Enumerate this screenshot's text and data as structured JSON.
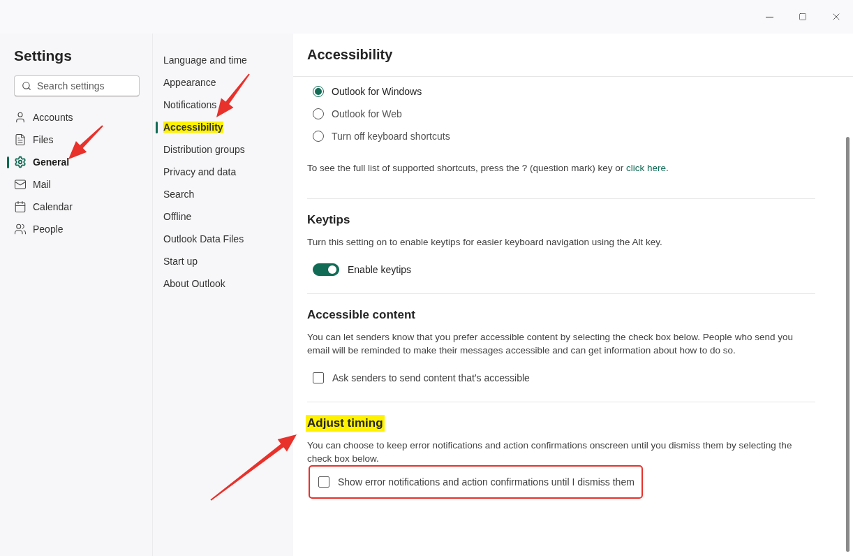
{
  "nav": {
    "title": "Settings",
    "search": {
      "placeholder": "Search settings"
    },
    "items": [
      {
        "label": "Accounts",
        "selected": false
      },
      {
        "label": "Files",
        "selected": false
      },
      {
        "label": "General",
        "selected": true
      },
      {
        "label": "Mail",
        "selected": false
      },
      {
        "label": "Calendar",
        "selected": false
      },
      {
        "label": "People",
        "selected": false
      }
    ]
  },
  "subnav": {
    "items": [
      {
        "label": "Language and time",
        "selected": false,
        "highlighted": false
      },
      {
        "label": "Appearance",
        "selected": false,
        "highlighted": false
      },
      {
        "label": "Notifications",
        "selected": false,
        "highlighted": false
      },
      {
        "label": "Accessibility",
        "selected": true,
        "highlighted": true
      },
      {
        "label": "Distribution groups",
        "selected": false,
        "highlighted": false
      },
      {
        "label": "Privacy and data",
        "selected": false,
        "highlighted": false
      },
      {
        "label": "Search",
        "selected": false,
        "highlighted": false
      },
      {
        "label": "Offline",
        "selected": false,
        "highlighted": false
      },
      {
        "label": "Outlook Data Files",
        "selected": false,
        "highlighted": false
      },
      {
        "label": "Start up",
        "selected": false,
        "highlighted": false
      },
      {
        "label": "About Outlook",
        "selected": false,
        "highlighted": false
      }
    ]
  },
  "panel": {
    "title": "Accessibility",
    "sections": [
      {
        "kind": "radio",
        "options": [
          {
            "label": "Outlook for Windows",
            "selected": true
          },
          {
            "label": "Outlook for Web",
            "selected": false
          },
          {
            "label": "Turn off keyboard shortcuts",
            "selected": false
          }
        ],
        "note": {
          "before": "To see the full list of supported shortcuts, press the ? (question mark) key or ",
          "link": "click here",
          "after": "."
        }
      },
      {
        "kind": "toggle",
        "heading": "Keytips",
        "highlighted": false,
        "description": "Turn this setting on to enable keytips for easier keyboard navigation using the Alt key.",
        "label": "Enable keytips",
        "on": true
      },
      {
        "kind": "checkbox",
        "heading": "Accessible content",
        "highlighted": false,
        "description": "You can let senders know that you prefer accessible content by selecting the check box below. People who send you email will be reminded to make their messages accessible and can get information about how to do so.",
        "label": "Ask senders to send content that's accessible",
        "checked": false,
        "outlined": false
      },
      {
        "kind": "checkbox",
        "heading": "Adjust timing",
        "highlighted": true,
        "description": "You can choose to keep error notifications and action confirmations onscreen until you dismiss them by selecting the check box below.",
        "label": "Show error notifications and action confirmations until I dismiss them",
        "checked": false,
        "outlined": true
      }
    ]
  }
}
